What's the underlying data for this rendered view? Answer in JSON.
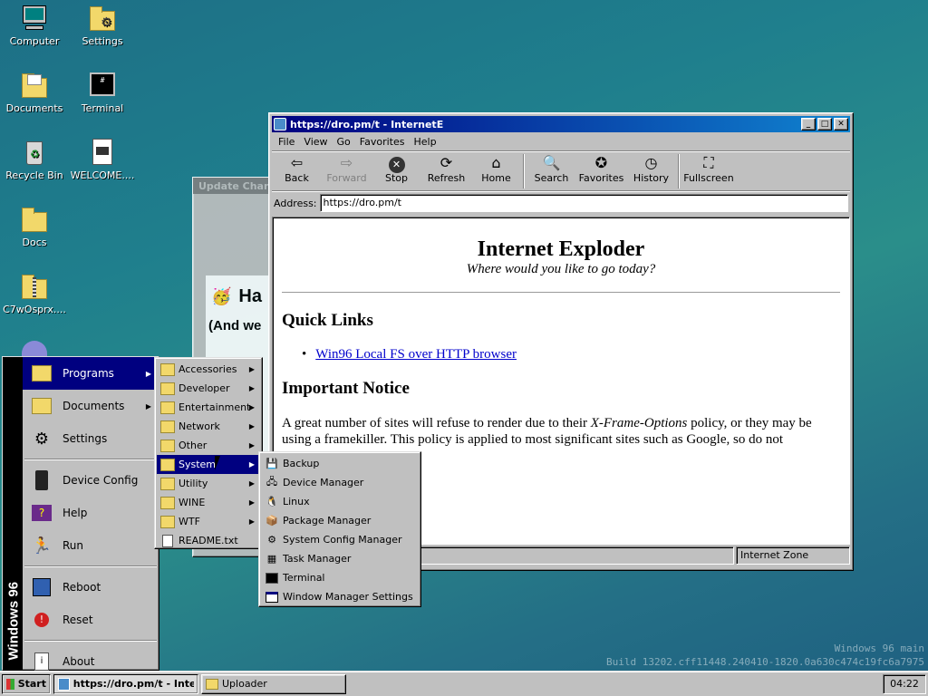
{
  "desktop": {
    "icons": [
      {
        "label": "Computer",
        "icon": "computer-icon"
      },
      {
        "label": "Settings",
        "icon": "settings-folder-icon"
      },
      {
        "label": "Documents",
        "icon": "documents-folder-icon"
      },
      {
        "label": "Terminal",
        "icon": "terminal-icon"
      },
      {
        "label": "Recycle Bin",
        "icon": "recycle-bin-icon"
      },
      {
        "label": "WELCOME....",
        "icon": "document-icon"
      },
      {
        "label": "Docs",
        "icon": "folder-icon"
      },
      {
        "label": "C7wOsprx....",
        "icon": "zip-folder-icon"
      }
    ],
    "watermark_line1": "Windows 96 main",
    "watermark_line2": "Build 13202.cff11448.240410-1820.0a630c474c19fc6a7975"
  },
  "update_window": {
    "title": "Update Chan",
    "heading": "Ha",
    "subheading": "(And we",
    "icon": "party-face-icon"
  },
  "browser": {
    "title": "https://dro.pm/t - InternetE",
    "menu": [
      "File",
      "View",
      "Go",
      "Favorites",
      "Help"
    ],
    "toolbar": [
      {
        "label": "Back",
        "icon": "back-arrow-icon",
        "enabled": true
      },
      {
        "label": "Forward",
        "icon": "forward-arrow-icon",
        "enabled": false
      },
      {
        "label": "Stop",
        "icon": "stop-icon",
        "enabled": true
      },
      {
        "label": "Refresh",
        "icon": "refresh-icon",
        "enabled": true
      },
      {
        "label": "Home",
        "icon": "home-icon",
        "enabled": true
      },
      {
        "label": "Search",
        "icon": "search-icon",
        "enabled": true
      },
      {
        "label": "Favorites",
        "icon": "favorites-icon",
        "enabled": true
      },
      {
        "label": "History",
        "icon": "history-icon",
        "enabled": true
      },
      {
        "label": "Fullscreen",
        "icon": "fullscreen-icon",
        "enabled": true
      }
    ],
    "address_label": "Address:",
    "address_value": "https://dro.pm/t",
    "page": {
      "title": "Internet Exploder",
      "tagline": "Where would you like to go today?",
      "quick_links_heading": "Quick Links",
      "link1": "Win96 Local FS over HTTP browser",
      "notice_heading": "Important Notice",
      "notice_text_a": "A great number of sites will refuse to render due to their ",
      "notice_text_em": "X-Frame-Options",
      "notice_text_b": " policy, or they may be using a framekiller. This policy is applied to most significant sites such as Google, so do not"
    },
    "status_zone": "Internet Zone"
  },
  "start_menu": {
    "brand": "Windows 96",
    "items": [
      {
        "label": "Programs",
        "icon": "programs-icon",
        "submenu": true
      },
      {
        "label": "Documents",
        "icon": "documents-icon",
        "submenu": true
      },
      {
        "label": "Settings",
        "icon": "settings-icon",
        "submenu": false
      },
      {
        "label": "Device Config",
        "icon": "device-config-icon",
        "submenu": false
      },
      {
        "label": "Help",
        "icon": "help-book-icon",
        "submenu": false
      },
      {
        "label": "Run",
        "icon": "run-icon",
        "submenu": false
      },
      {
        "label": "Reboot",
        "icon": "reboot-icon",
        "submenu": false
      },
      {
        "label": "Reset",
        "icon": "reset-icon",
        "submenu": false
      },
      {
        "label": "About",
        "icon": "about-icon",
        "submenu": false
      }
    ]
  },
  "programs_menu": {
    "items": [
      "Accessories",
      "Developer",
      "Entertainment",
      "Network",
      "Other",
      "System",
      "Utility",
      "WINE",
      "WTF",
      "README.txt"
    ]
  },
  "system_menu": {
    "items": [
      {
        "label": "Backup",
        "icon": "backup-icon"
      },
      {
        "label": "Device Manager",
        "icon": "device-manager-icon"
      },
      {
        "label": "Linux",
        "icon": "linux-penguin-icon"
      },
      {
        "label": "Package Manager",
        "icon": "package-icon"
      },
      {
        "label": "System Config Manager",
        "icon": "config-gear-icon"
      },
      {
        "label": "Task Manager",
        "icon": "task-manager-icon"
      },
      {
        "label": "Terminal",
        "icon": "terminal-icon"
      },
      {
        "label": "Window Manager Settings",
        "icon": "window-settings-icon"
      }
    ]
  },
  "taskbar": {
    "start_label": "Start",
    "tasks": [
      {
        "label": "https://dro.pm/t - Inte...",
        "active": true
      },
      {
        "label": "Uploader",
        "active": false
      }
    ],
    "clock": "04:22"
  }
}
